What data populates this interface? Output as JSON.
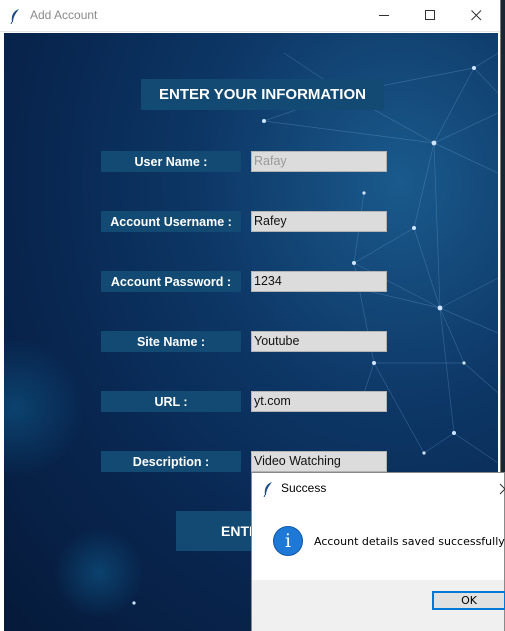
{
  "window": {
    "title": "Add Account",
    "icon": "feather-icon",
    "controls": [
      "minimize-icon",
      "maximize-icon",
      "close-icon"
    ]
  },
  "form": {
    "heading": "ENTER YOUR INFORMATION",
    "fields": [
      {
        "label": "User Name :",
        "value": "Rafay",
        "disabled": true
      },
      {
        "label": "Account Username :",
        "value": "Rafey"
      },
      {
        "label": "Account Password :",
        "value": "1234"
      },
      {
        "label": "Site Name :",
        "value": "Youtube"
      },
      {
        "label": "URL :",
        "value": "yt.com"
      },
      {
        "label": "Description :",
        "value": "Video Watching"
      }
    ],
    "enter_button": "ENTE"
  },
  "dialog": {
    "title": "Success",
    "icon": "info-icon",
    "message": "Account details saved successfully!",
    "ok_label": "OK"
  },
  "colors": {
    "label_bg": "#134a73",
    "background_deep": "#061a3a",
    "background_light": "#1a5a8c",
    "ok_border": "#0078d7",
    "info_icon": "#1e78d6"
  }
}
